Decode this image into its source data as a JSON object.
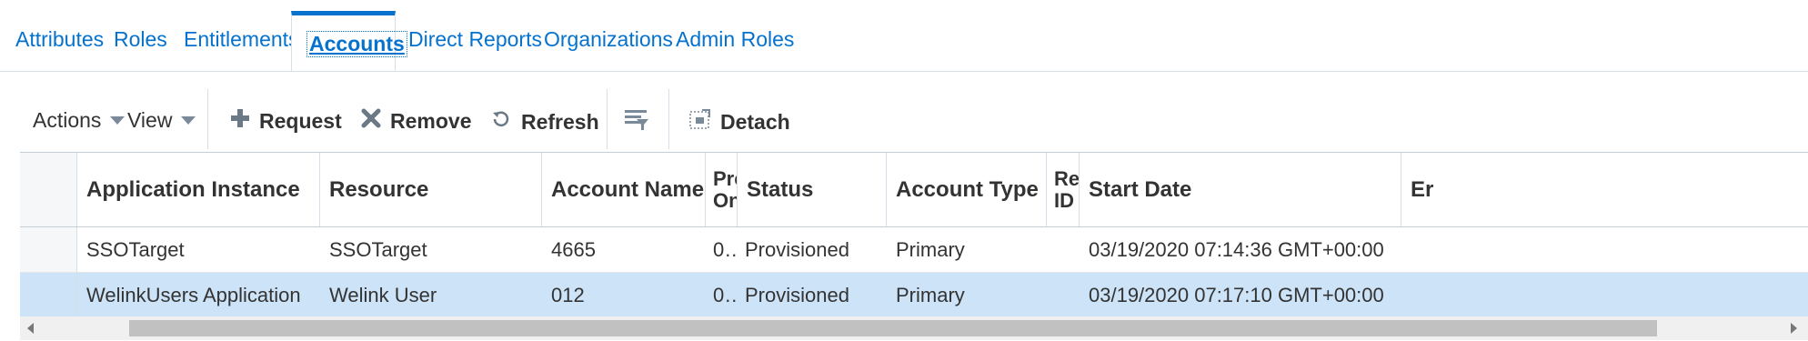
{
  "tabs": [
    {
      "label": "Attributes"
    },
    {
      "label": "Roles"
    },
    {
      "label": "Entitlements"
    },
    {
      "label": "Accounts",
      "active": true
    },
    {
      "label": "Direct Reports"
    },
    {
      "label": "Organizations"
    },
    {
      "label": "Admin Roles"
    }
  ],
  "toolbar": {
    "actions_label": "Actions",
    "view_label": "View",
    "request_label": "Request",
    "remove_label": "Remove",
    "refresh_label": "Refresh",
    "detach_label": "Detach"
  },
  "table": {
    "columns": [
      "Application Instance",
      "Resource",
      "Account Name",
      "Prc On",
      "Status",
      "Account Type",
      "Re ID",
      "Start Date",
      "Er"
    ],
    "rows": [
      [
        "SSOTarget",
        "SSOTarget",
        "4665",
        "0…",
        "Provisioned",
        "Primary",
        "",
        "03/19/2020 07:14:36 GMT+00:00",
        ""
      ],
      [
        "WelinkUsers Application",
        "Welink User",
        "012",
        "0…",
        "Provisioned",
        "Primary",
        "",
        "03/19/2020 07:17:10 GMT+00:00",
        ""
      ]
    ],
    "selected_row": 1
  },
  "colors": {
    "link": "#0572ce",
    "selected_row": "#cde3f7",
    "border": "#d6dfe6"
  }
}
